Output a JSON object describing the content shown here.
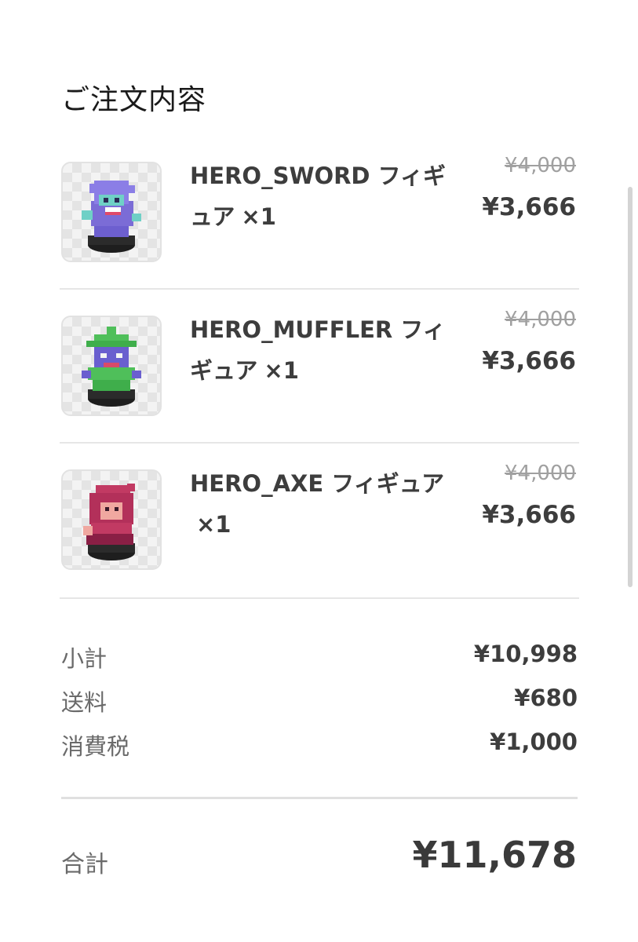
{
  "title": "ご注文内容",
  "items": [
    {
      "name": "HERO_SWORD フィギュア",
      "qty": "×1",
      "original_price": "¥4,000",
      "price": "¥3,666",
      "icon": "purple-knight-figure-icon",
      "color": "#7b6cd6"
    },
    {
      "name": "HERO_MUFFLER フィギュア",
      "qty": "×1",
      "original_price": "¥4,000",
      "price": "¥3,666",
      "icon": "green-hat-figure-icon",
      "color": "#4fbf5a"
    },
    {
      "name": "HERO_AXE フィギュア",
      "qty": "×1",
      "original_price": "¥4,000",
      "price": "¥3,666",
      "icon": "red-hood-figure-icon",
      "color": "#c23a63"
    }
  ],
  "summary": {
    "subtotal_label": "小計",
    "subtotal_value": "¥10,998",
    "shipping_label": "送料",
    "shipping_value": "¥680",
    "tax_label": "消費税",
    "tax_value": "¥1,000"
  },
  "total": {
    "label": "合計",
    "value": "¥11,678"
  }
}
